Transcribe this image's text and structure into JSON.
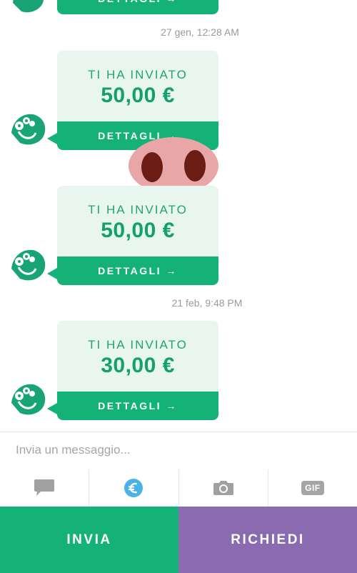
{
  "conversation": {
    "timestamps": [
      "27 gen, 12:28 AM",
      "21 feb, 9:48 PM"
    ],
    "messages": [
      {
        "label": "",
        "amount": "",
        "button": "DETTAGLI →"
      },
      {
        "label": "TI HA INVIATO",
        "amount": "50,00 €",
        "button": "DETTAGLI →"
      },
      {
        "label": "TI HA INVIATO",
        "amount": "50,00 €",
        "button": "DETTAGLI →"
      },
      {
        "label": "TI HA INVIATO",
        "amount": "30,00 €",
        "button": "DETTAGLI →"
      }
    ],
    "sticker": "pig-snout"
  },
  "composer": {
    "placeholder": "Invia un messaggio..."
  },
  "toolbar": {
    "icons": [
      "chat-bubble-icon",
      "euro-icon",
      "camera-icon",
      "gif-icon"
    ],
    "gif_label": "GIF",
    "active_color": "#4ab3e6"
  },
  "actions": {
    "send_label": "INVIA",
    "request_label": "RICHIEDI"
  },
  "colors": {
    "green": "#15b278",
    "purple": "#8a6bb0",
    "card_bg": "#e8f6ef"
  }
}
